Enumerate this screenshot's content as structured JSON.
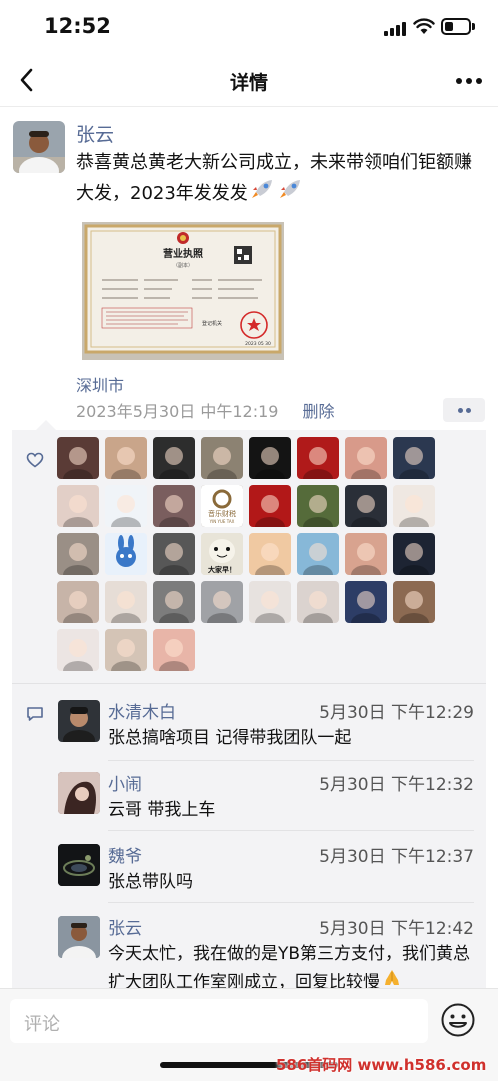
{
  "status": {
    "time": "12:52",
    "battery_level": 0.35
  },
  "nav": {
    "title": "详情",
    "back_icon": "chevron-left-icon",
    "more_icon": "ellipsis-icon"
  },
  "post": {
    "author": "张云",
    "text": "恭喜黄总黄老大新公司成立，未来带领咱们钜额赚大发，2023年发发发",
    "text_emoji": "rocket-icon",
    "image": {
      "heading": "营业执照",
      "subheading": "（副本）",
      "seal": "登记机关",
      "date": "2023 05 30"
    },
    "location": "深圳市",
    "timestamp": "2023年5月30日 中午12:19",
    "delete_label": "删除"
  },
  "likes": {
    "icon": "heart-icon",
    "avatars": [
      {
        "c": "#5a3b36"
      },
      {
        "c": "#c9a58a"
      },
      {
        "c": "#2d2d2d"
      },
      {
        "c": "#8c8272"
      },
      {
        "c": "#141414"
      },
      {
        "c": "#b01a1a"
      },
      {
        "c": "#d89a8a"
      },
      {
        "c": "#2b3850"
      },
      {
        "c": "#e2cfc7"
      },
      {
        "c": "#f0f4f8"
      },
      {
        "c": "#7a5e5e"
      },
      {
        "c": "#7a6a58"
      },
      {
        "c": "#b21818"
      },
      {
        "c": "#556b3a"
      },
      {
        "c": "#2a2f38"
      },
      {
        "c": "#efe8e2"
      },
      {
        "c": "#9a8f86"
      },
      {
        "c": "#e8f1fb"
      },
      {
        "c": "#575757"
      },
      {
        "c": "#ddd8cb"
      },
      {
        "c": "#f0c9a2"
      },
      {
        "c": "#87b8d8"
      },
      {
        "c": "#d8a38f"
      },
      {
        "c": "#1d2433"
      },
      {
        "c": "#c7b4a8"
      },
      {
        "c": "#e6ddd6"
      },
      {
        "c": "#7c7c7c"
      },
      {
        "c": "#a0a2a6"
      },
      {
        "c": "#e7e2df"
      },
      {
        "c": "#dbd3cf"
      },
      {
        "c": "#2d3d66"
      },
      {
        "c": "#8c6a52"
      },
      {
        "c": "#ece5e3"
      },
      {
        "c": "#d4c4b6"
      },
      {
        "c": "#e8b5a8"
      }
    ],
    "special": {
      "music_label": "音乐财税",
      "music_sub": "YIN YUE TAX",
      "meme_label": "大家早！"
    }
  },
  "comments_icon": "comment-bubble-icon",
  "comments": [
    {
      "name": "水清木白",
      "time": "5月30日 下午12:29",
      "text": "张总搞啥项目 记得带我团队一起",
      "avatar_color": "#2f3338"
    },
    {
      "name": "小闹",
      "time": "5月30日 下午12:32",
      "text": "云哥 带我上车",
      "avatar_color": "#6e4a49"
    },
    {
      "name": "魏爷",
      "time": "5月30日 下午12:37",
      "text": "张总带队吗",
      "avatar_color": "#1a1d20"
    },
    {
      "name": "张云",
      "time": "5月30日 下午12:42",
      "text": "今天太忙，我在做的是YB第三方支付，我们黄总扩大团队工作室刚成立，回复比较慢",
      "text_emoji": "pray-icon",
      "avatar_color": "#7d8a98"
    }
  ],
  "input": {
    "placeholder": "评论",
    "emoji_icon": "emoji-icon"
  },
  "watermark": "586首码网 www.h586.com"
}
